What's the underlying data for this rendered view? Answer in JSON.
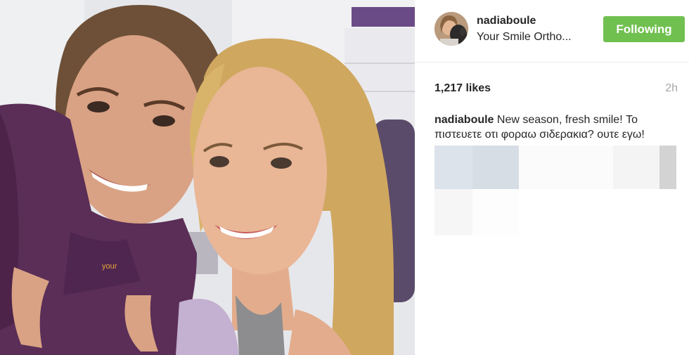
{
  "post": {
    "username": "nadiaboule",
    "location": "Your Smile Ortho...",
    "follow_label": "Following",
    "likes": "1,217 likes",
    "time": "2h",
    "caption": {
      "username": "nadiaboule",
      "text": "New season, fresh smile! Το πιστευετε οτι φοραω σιδερακια? ουτε εγω!"
    }
  },
  "photo": {
    "shirt_text": "your"
  },
  "colors": {
    "follow_button": "#70c050",
    "text": "#262626",
    "muted": "#a5a7aa",
    "divider": "#efefef"
  },
  "icons": [
    "avatar"
  ]
}
